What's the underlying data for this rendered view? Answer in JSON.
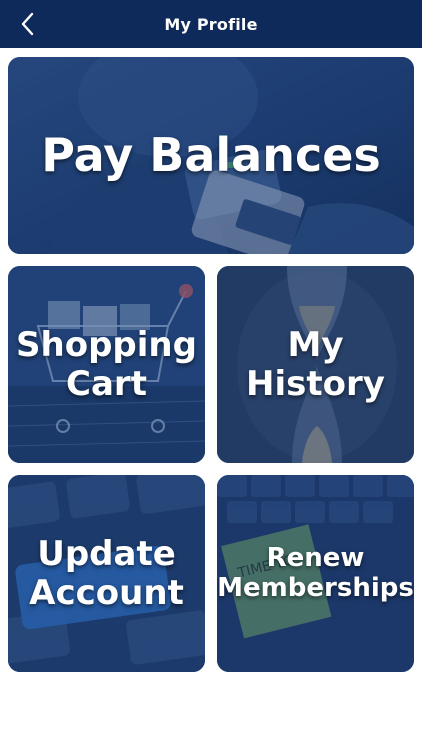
{
  "header": {
    "title": "My Profile",
    "back_icon": "chevron-left-icon"
  },
  "tiles": [
    {
      "label": "Pay Balances"
    },
    {
      "label": "Shopping\nCart"
    },
    {
      "label": "My History"
    },
    {
      "label": "Update\nAccount"
    },
    {
      "label": "Renew\nMemberships"
    }
  ],
  "decor": {
    "sticky_note_text": "TIME TO"
  },
  "colors": {
    "header_bg": "#0e2a5a",
    "tile_overlay": "#1a3a6e",
    "text": "#ffffff"
  }
}
